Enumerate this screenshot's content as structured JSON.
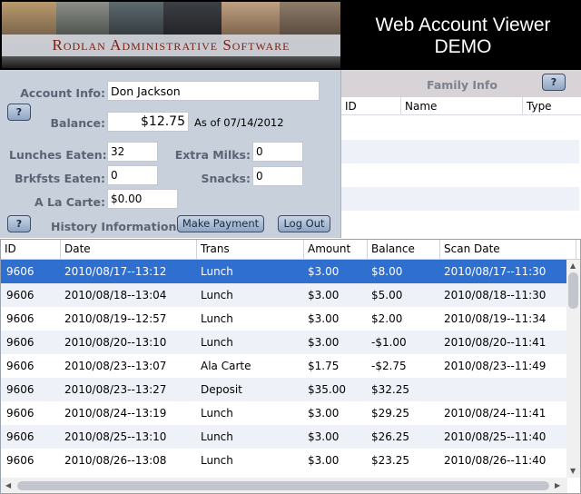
{
  "header": {
    "banner_text": "Rodlan Administrative Software",
    "title_line1": "Web Account Viewer",
    "title_line2": "DEMO"
  },
  "account": {
    "info_label": "Account Info:",
    "name": "Don  Jackson",
    "help_label": "?",
    "balance_label": "Balance:",
    "balance": "$12.75",
    "as_of": "As of 07/14/2012",
    "lunches_label": "Lunches Eaten:",
    "lunches": "32",
    "extra_milks_label": "Extra Milks:",
    "extra_milks": "0",
    "breakfasts_label": "Brkfsts Eaten:",
    "breakfasts": "0",
    "snacks_label": "Snacks:",
    "snacks": "0",
    "alacarte_label": "A La Carte:",
    "alacarte": "$0.00",
    "history_label": "History Information",
    "make_payment_label": "Make Payment",
    "logout_label": "Log Out"
  },
  "family": {
    "title": "Family Info",
    "help_label": "?",
    "columns": [
      "ID",
      "Name",
      "Type"
    ]
  },
  "history": {
    "columns": [
      "ID",
      "Date",
      "Trans",
      "Amount",
      "Balance",
      "Scan Date"
    ],
    "rows": [
      [
        "9606",
        "2010/08/17--13:12",
        "Lunch",
        "$3.00",
        "$8.00",
        "2010/08/17--11:30"
      ],
      [
        "9606",
        "2010/08/18--13:04",
        "Lunch",
        "$3.00",
        "$5.00",
        "2010/08/18--11:30"
      ],
      [
        "9606",
        "2010/08/19--12:57",
        "Lunch",
        "$3.00",
        "$2.00",
        "2010/08/19--11:34"
      ],
      [
        "9606",
        "2010/08/20--13:10",
        "Lunch",
        "$3.00",
        "-$1.00",
        "2010/08/20--11:41"
      ],
      [
        "9606",
        "2010/08/23--13:07",
        "Ala Carte",
        "$1.75",
        "-$2.75",
        "2010/08/23--11:49"
      ],
      [
        "9606",
        "2010/08/23--13:27",
        "Deposit",
        "$35.00",
        "$32.25",
        ""
      ],
      [
        "9606",
        "2010/08/24--13:19",
        "Lunch",
        "$3.00",
        "$29.25",
        "2010/08/24--11:41"
      ],
      [
        "9606",
        "2010/08/25--13:10",
        "Lunch",
        "$3.00",
        "$26.25",
        "2010/08/25--11:40"
      ],
      [
        "9606",
        "2010/08/26--13:08",
        "Lunch",
        "$3.00",
        "$23.25",
        "2010/08/26--11:40"
      ]
    ]
  }
}
